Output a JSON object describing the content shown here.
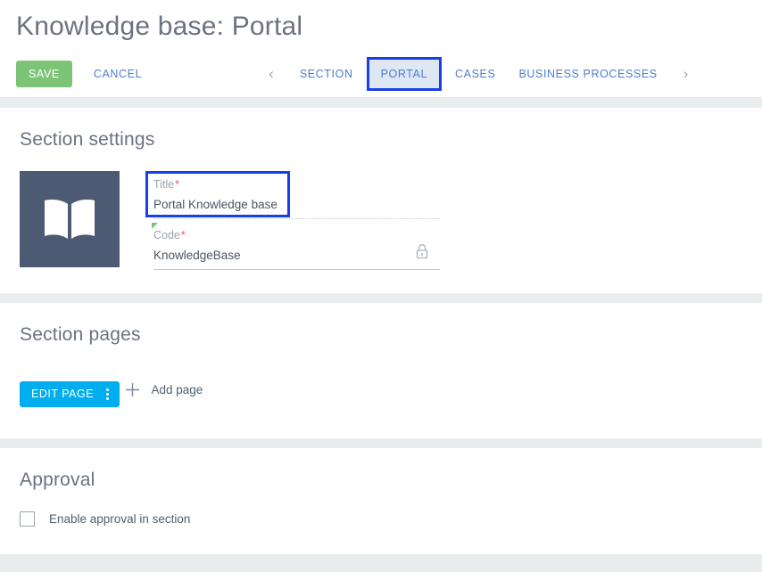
{
  "header": {
    "title": "Knowledge base: Portal"
  },
  "toolbar": {
    "save_label": "SAVE",
    "cancel_label": "CANCEL",
    "prev_arrow": "‹",
    "next_arrow": "›",
    "tabs": [
      {
        "label": "SECTION",
        "active": false
      },
      {
        "label": "PORTAL",
        "active": true
      },
      {
        "label": "CASES",
        "active": false
      },
      {
        "label": "BUSINESS PROCESSES",
        "active": false
      }
    ]
  },
  "sections": {
    "settings": {
      "title": "Section settings",
      "image_icon": "open-book-icon",
      "title_field": {
        "label": "Title",
        "required_mark": "*",
        "value": "Portal Knowledge base"
      },
      "code_field": {
        "label": "Code",
        "required_mark": "*",
        "value": "KnowledgeBase",
        "lock_icon": "lock-icon"
      }
    },
    "pages": {
      "title": "Section pages",
      "edit_page_label": "EDIT PAGE",
      "add_page_label": "Add page",
      "plus_icon": "plus-icon",
      "kebab_icon": "more-vertical-icon"
    },
    "approval": {
      "title": "Approval",
      "checkbox_label": "Enable approval in section",
      "checked": false
    }
  },
  "colors": {
    "save_green": "#7cc576",
    "link_blue": "#4d7ecf",
    "edit_cyan": "#00AEEF",
    "highlight_blue": "#1a3fe8",
    "tab_active_bg": "#dfe7f5",
    "image_bg": "#4c5a74",
    "band_gray": "#e9edee",
    "required_red": "#ef5350"
  }
}
